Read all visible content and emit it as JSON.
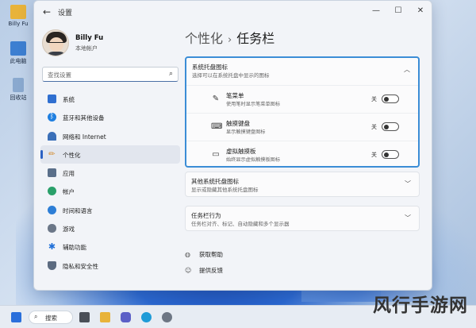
{
  "desktop": {
    "icons": [
      {
        "label": "Billy Fu",
        "icon": "folder-icon",
        "color": "#e8b33a"
      },
      {
        "label": "此电脑",
        "icon": "computer-icon",
        "color": "#3d7fd1"
      },
      {
        "label": "回收站",
        "icon": "recycle-bin-icon",
        "color": "#8aa9cf"
      }
    ]
  },
  "window": {
    "title": "设置",
    "back": "←",
    "minimize": "—",
    "maximize": "☐",
    "close": "✕"
  },
  "profile": {
    "name": "Billy Fu",
    "account_type": "本地帐户"
  },
  "search": {
    "placeholder": "查找设置",
    "icon": "search-icon"
  },
  "nav": {
    "items": [
      {
        "label": "系统",
        "icon": "display-icon",
        "color": "#2f6fd0"
      },
      {
        "label": "蓝牙和其他设备",
        "icon": "bluetooth-icon",
        "color": "#1f7fe0"
      },
      {
        "label": "网络和 Internet",
        "icon": "wifi-icon",
        "color": "#3a6fb8"
      },
      {
        "label": "个性化",
        "icon": "brush-icon",
        "color": "#d38a2c"
      },
      {
        "label": "应用",
        "icon": "apps-icon",
        "color": "#5a6f8a"
      },
      {
        "label": "帐户",
        "icon": "person-icon",
        "color": "#2aa06a"
      },
      {
        "label": "时间和语言",
        "icon": "globe-clock-icon",
        "color": "#2d7ed6"
      },
      {
        "label": "游戏",
        "icon": "gamepad-icon",
        "color": "#6b7788"
      },
      {
        "label": "辅助功能",
        "icon": "accessibility-icon",
        "color": "#1f6fd8"
      },
      {
        "label": "隐私和安全性",
        "icon": "shield-icon",
        "color": "#5c6b80"
      }
    ],
    "active_index": 3
  },
  "breadcrumb": {
    "parent": "个性化",
    "separator": "›",
    "current": "任务栏"
  },
  "sections": {
    "tray_icons": {
      "title": "系统托盘图标",
      "subtitle": "选择可以在系统托盘中显示的图标",
      "chevron": "︿",
      "rows": [
        {
          "title": "笔菜单",
          "subtitle": "使用笔时显示笔菜单图标",
          "state": "关",
          "on": false,
          "icon": "pen-icon",
          "glyph": "✎"
        },
        {
          "title": "触摸键盘",
          "subtitle": "显示触摸键盘图标",
          "state": "关",
          "on": false,
          "icon": "keyboard-icon",
          "glyph": "⌨"
        },
        {
          "title": "虚拟触摸板",
          "subtitle": "始终显示虚拟触摸板图标",
          "state": "关",
          "on": false,
          "icon": "touchpad-icon",
          "glyph": "▭"
        }
      ]
    },
    "other_tray": {
      "title": "其他系统托盘图标",
      "subtitle": "显示或隐藏其他系统托盘图标",
      "chevron": "﹀"
    },
    "behaviors": {
      "title": "任务栏行为",
      "subtitle": "任务栏对齐、标记、自动隐藏和多个显示器",
      "chevron": "﹀"
    }
  },
  "links": [
    {
      "label": "获取帮助",
      "icon": "help-icon",
      "glyph": "◍"
    },
    {
      "label": "提供反馈",
      "icon": "feedback-icon",
      "glyph": "☺"
    }
  ],
  "taskbar": {
    "search_label": "搜索",
    "apps": [
      {
        "icon": "start-icon",
        "color": "#2a6fdb"
      },
      {
        "icon": "task-view-icon",
        "color": "#4a4f58"
      },
      {
        "icon": "file-explorer-icon",
        "color": "#e8b33a"
      },
      {
        "icon": "chat-icon",
        "color": "#5b5fc7"
      },
      {
        "icon": "edge-icon",
        "color": "#1e9bd7"
      },
      {
        "icon": "store-icon",
        "color": "#3a7ad6"
      },
      {
        "icon": "settings-icon",
        "color": "#6d7684"
      }
    ]
  },
  "watermark": "风行手游网"
}
